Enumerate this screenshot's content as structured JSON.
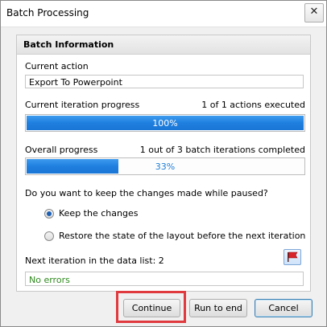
{
  "window": {
    "title": "Batch Processing",
    "close_glyph": "✕"
  },
  "panel": {
    "header": "Batch Information",
    "current_action": {
      "label": "Current action",
      "value": "Export To Powerpoint"
    },
    "iteration_progress": {
      "label": "Current iteration progress",
      "status": "1 of 1 actions executed",
      "percent_text": "100%",
      "fraction": 1.0
    },
    "overall_progress": {
      "label": "Overall progress",
      "status": "1 out of 3 batch iterations completed",
      "percent_text": "33%",
      "fraction": 0.33
    },
    "question": "Do you want to keep the changes made while paused?",
    "options": [
      {
        "label": "Keep the changes",
        "selected": true
      },
      {
        "label": "Restore the state of the layout before the next iteration",
        "selected": false
      }
    ],
    "next_iteration": "Next iteration in the data list: 2",
    "flag_icon": "red-flag-icon",
    "errors_text": "No errors"
  },
  "buttons": {
    "continue": "Continue",
    "run_to_end": "Run to end",
    "cancel": "Cancel"
  },
  "colors": {
    "progress_fill": "#1f7fdf",
    "errors_text": "#2f8a1e",
    "highlight": "#e0393e"
  }
}
